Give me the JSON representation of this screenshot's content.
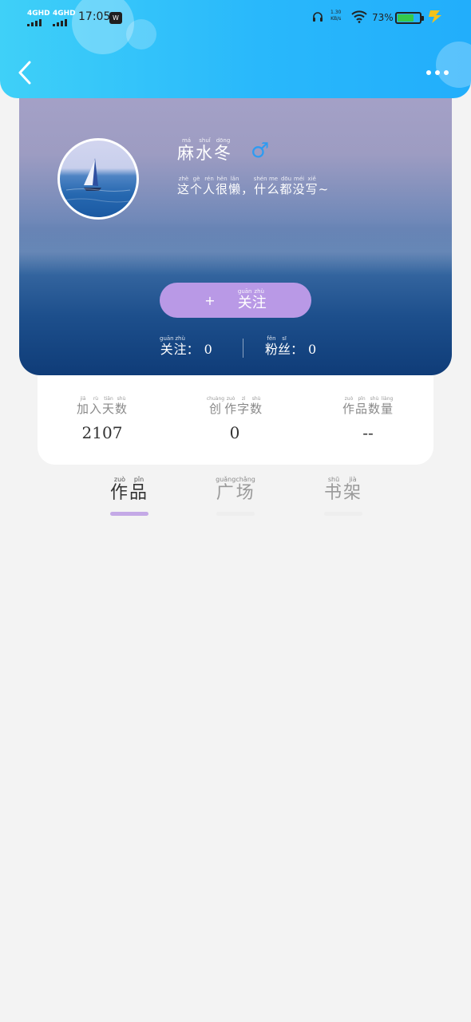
{
  "status_bar": {
    "sim1": "4GHD",
    "sim2": "4GHD",
    "time": "17:05",
    "app_indicator": "W",
    "net_speed_value": "1.30",
    "net_speed_unit": "KB/s",
    "battery_percent": "73%",
    "battery_level": 0.73
  },
  "header": {
    "back_icon": "chevron-left-icon",
    "more_icon": "more-dots-icon"
  },
  "profile": {
    "name": {
      "chars": [
        "麻",
        "水",
        "冬"
      ],
      "pinyin": [
        "má",
        "shuǐ",
        "dōng"
      ]
    },
    "gender_symbol": "♂",
    "bio": {
      "chars": [
        "这",
        "个",
        "人",
        "很",
        "懒",
        "，",
        "什",
        "么",
        "都",
        "没",
        "写",
        "~"
      ],
      "pinyin": [
        "zhè",
        "gè",
        "rén",
        "hěn",
        "lǎn",
        "",
        "shén",
        "me",
        "dōu",
        "méi",
        "xiě",
        ""
      ]
    },
    "follow_button": {
      "plus": "+",
      "chars": [
        "关",
        "注"
      ],
      "pinyin": [
        "guān",
        "zhù"
      ]
    },
    "following": {
      "chars": [
        "关",
        "注"
      ],
      "pinyin": [
        "guān",
        "zhù"
      ],
      "colon": "：",
      "count": "0"
    },
    "fans": {
      "chars": [
        "粉",
        "丝"
      ],
      "pinyin": [
        "fěn",
        "sī"
      ],
      "colon": "：",
      "count": "0"
    }
  },
  "info": [
    {
      "chars": [
        "加",
        "入",
        "天",
        "数"
      ],
      "pinyin": [
        "jiā",
        "rù",
        "tiān",
        "shù"
      ],
      "value": "2107"
    },
    {
      "chars": [
        "创",
        "作",
        "字",
        "数"
      ],
      "pinyin": [
        "chuàng",
        "zuò",
        "zì",
        "shù"
      ],
      "value": "0"
    },
    {
      "chars": [
        "作",
        "品",
        "数",
        "量"
      ],
      "pinyin": [
        "zuò",
        "pǐn",
        "shù",
        "liàng"
      ],
      "value": "--"
    }
  ],
  "tabs": [
    {
      "chars": [
        "作",
        "品"
      ],
      "pinyin": [
        "zuò",
        "pǐn"
      ],
      "active": true
    },
    {
      "chars": [
        "广",
        "场"
      ],
      "pinyin": [
        "guǎng",
        "chǎng"
      ],
      "active": false
    },
    {
      "chars": [
        "书",
        "架"
      ],
      "pinyin": [
        "shū",
        "jià"
      ],
      "active": false
    }
  ],
  "colors": {
    "header_gradient_start": "#3fd0f8",
    "header_gradient_end": "#22aefb",
    "follow_button": "#b999e6",
    "gender_icon": "#2e9bf2",
    "tab_indicator_active": "#c4a9e6",
    "battery_fill": "#35c94a"
  }
}
